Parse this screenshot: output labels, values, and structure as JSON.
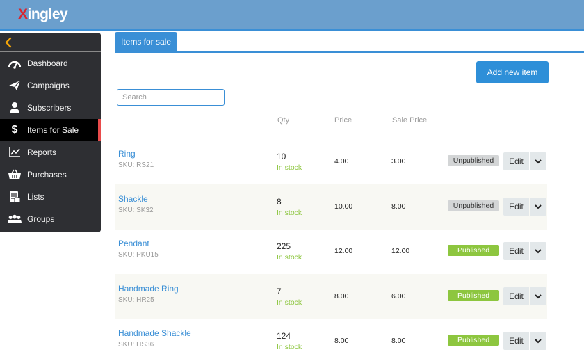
{
  "app": {
    "logo_first": "X",
    "logo_rest": "ingley"
  },
  "sidebar": {
    "back_icon": "chevron-left-icon",
    "items": [
      {
        "label": "Dashboard",
        "icon": "speedometer-icon"
      },
      {
        "label": "Campaigns",
        "icon": "paper-plane-icon"
      },
      {
        "label": "Subscribers",
        "icon": "user-icon"
      },
      {
        "label": "Items for Sale",
        "icon": "dollar-icon",
        "active": true
      },
      {
        "label": "Reports",
        "icon": "line-chart-icon"
      },
      {
        "label": "Purchases",
        "icon": "basket-icon"
      },
      {
        "label": "Lists",
        "icon": "list-icon"
      },
      {
        "label": "Groups",
        "icon": "group-icon"
      }
    ]
  },
  "tabs": {
    "active_label": "Items for sale"
  },
  "toolbar": {
    "add_label": "Add new item"
  },
  "search": {
    "placeholder": "Search",
    "value": ""
  },
  "table": {
    "headers": {
      "qty": "Qty",
      "price": "Price",
      "sale_price": "Sale Price"
    },
    "rows": [
      {
        "name": "Ring",
        "sku": "SKU: RS21",
        "qty": "10",
        "stock": "In stock",
        "price": "4.00",
        "sale_price": "3.00",
        "status": "Unpublished",
        "edit": "Edit"
      },
      {
        "name": "Shackle",
        "sku": "SKU: SK32",
        "qty": "8",
        "stock": "In stock",
        "price": "10.00",
        "sale_price": "8.00",
        "status": "Unpublished",
        "edit": "Edit"
      },
      {
        "name": "Pendant",
        "sku": "SKU: PKU15",
        "qty": "225",
        "stock": "In stock",
        "price": "12.00",
        "sale_price": "12.00",
        "status": "Published",
        "edit": "Edit"
      },
      {
        "name": "Handmade Ring",
        "sku": "SKU: HR25",
        "qty": "7",
        "stock": "In stock",
        "price": "8.00",
        "sale_price": "6.00",
        "status": "Published",
        "edit": "Edit"
      },
      {
        "name": "Handmade Shackle",
        "sku": "SKU: HS36",
        "qty": "124",
        "stock": "In stock",
        "price": "8.00",
        "sale_price": "8.00",
        "status": "Published",
        "edit": "Edit"
      }
    ]
  },
  "colors": {
    "header": "#6b9fcd",
    "accent": "#3a8fd6",
    "sidebar": "#2e2f33",
    "active_marker": "#e94b4b",
    "published": "#8dc63f",
    "unpublished": "#d3d5d6",
    "in_stock": "#8dc63f",
    "back_chevron": "#f0a30a"
  }
}
